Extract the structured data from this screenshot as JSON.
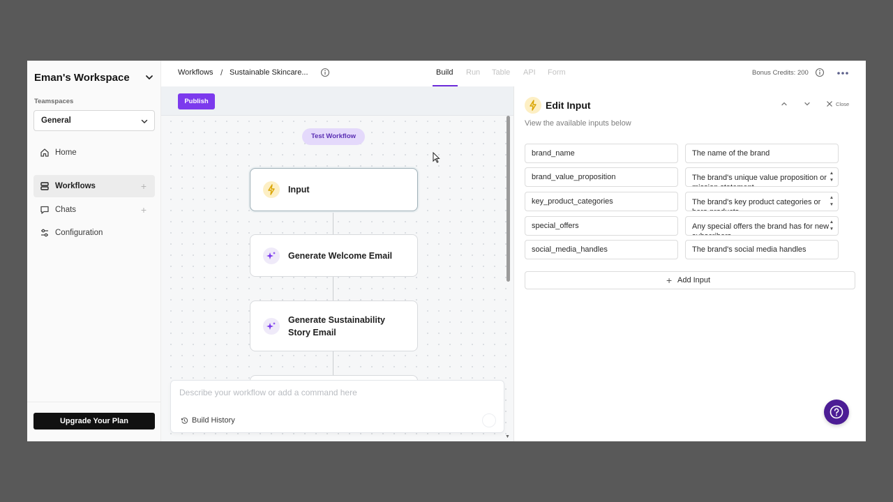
{
  "sidebar": {
    "workspace_title": "Eman's Workspace",
    "teamspaces_label": "Teamspaces",
    "teamspace_selected": "General",
    "items": [
      {
        "label": "Home",
        "icon": "home-icon"
      },
      {
        "label": "Workflows",
        "icon": "workflows-icon",
        "active": true
      },
      {
        "label": "Chats",
        "icon": "chat-icon"
      },
      {
        "label": "Configuration",
        "icon": "settings-sliders-icon"
      }
    ],
    "upgrade_label": "Upgrade Your Plan"
  },
  "header": {
    "breadcrumb_root": "Workflows",
    "breadcrumb_sep": "/",
    "breadcrumb_current": "Sustainable Skincare...",
    "tabs": [
      {
        "label": "Build",
        "active": true
      },
      {
        "label": "Run"
      },
      {
        "label": "Table"
      },
      {
        "label": "API"
      },
      {
        "label": "Form"
      }
    ],
    "credits": "Bonus Credits: 200"
  },
  "canvas": {
    "publish_label": "Publish",
    "test_label": "Test Workflow",
    "nodes": [
      {
        "label": "Input",
        "icon": "lightning-icon"
      },
      {
        "label": "Generate Welcome Email",
        "icon": "sparkle-icon"
      },
      {
        "label": "Generate Sustainability Story Email",
        "icon": "sparkle-icon"
      }
    ],
    "prompt_placeholder": "Describe your workflow or add a command here",
    "build_history_label": "Build History"
  },
  "panel": {
    "title": "Edit Input",
    "subtitle": "View the available inputs below",
    "close_label": "Close",
    "inputs": [
      {
        "name": "brand_name",
        "description": "The name of the brand"
      },
      {
        "name": "brand_value_proposition",
        "description": "The brand's unique value proposition or mission statement"
      },
      {
        "name": "key_product_categories",
        "description": "The brand's key product categories or hero products"
      },
      {
        "name": "special_offers",
        "description": "Any special offers the brand has for new subscribers"
      },
      {
        "name": "social_media_handles",
        "description": "The brand's social media handles"
      }
    ],
    "add_input_label": "Add Input"
  },
  "colors": {
    "accent": "#7c3aed",
    "help_button": "#4c1d95",
    "input_node_icon_bg": "#fdefc4"
  }
}
